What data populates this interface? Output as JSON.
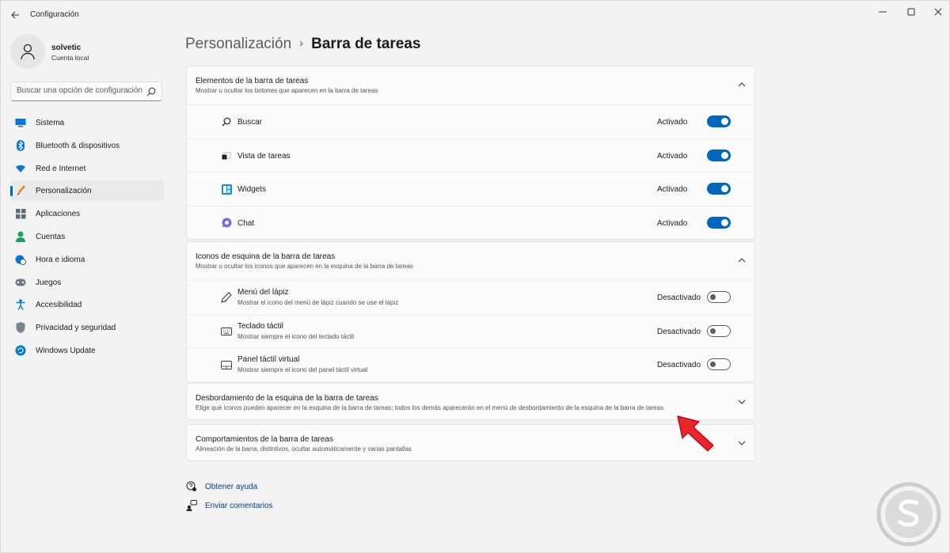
{
  "window": {
    "title": "Configuración",
    "controls": {
      "minimize": "—",
      "maximize": "☐",
      "close": "✕"
    }
  },
  "profile": {
    "name": "solvetic",
    "subtitle": "Cuenta local"
  },
  "search": {
    "placeholder": "Buscar una opción de configuración"
  },
  "sidebar": {
    "items": [
      {
        "label": "Sistema",
        "icon": "system-icon",
        "active": false
      },
      {
        "label": "Bluetooth & dispositivos",
        "icon": "bluetooth-icon",
        "active": false
      },
      {
        "label": "Red e Internet",
        "icon": "wifi-icon",
        "active": false
      },
      {
        "label": "Personalización",
        "icon": "brush-icon",
        "active": true
      },
      {
        "label": "Aplicaciones",
        "icon": "apps-icon",
        "active": false
      },
      {
        "label": "Cuentas",
        "icon": "person-icon",
        "active": false
      },
      {
        "label": "Hora e idioma",
        "icon": "globe-clock-icon",
        "active": false
      },
      {
        "label": "Juegos",
        "icon": "gamepad-icon",
        "active": false
      },
      {
        "label": "Accesibilidad",
        "icon": "accessibility-icon",
        "active": false
      },
      {
        "label": "Privacidad y seguridad",
        "icon": "shield-icon",
        "active": false
      },
      {
        "label": "Windows Update",
        "icon": "update-icon",
        "active": false
      }
    ]
  },
  "breadcrumb": {
    "parent": "Personalización",
    "separator": "›",
    "current": "Barra de tareas"
  },
  "sections": {
    "taskbar_items": {
      "title": "Elementos de la barra de tareas",
      "description": "Mostrar u ocultar los botones que aparecen en la barra de tareas",
      "rows": [
        {
          "label": "Buscar",
          "state": "Activado",
          "on": true
        },
        {
          "label": "Vista de tareas",
          "state": "Activado",
          "on": true
        },
        {
          "label": "Widgets",
          "state": "Activado",
          "on": true
        },
        {
          "label": "Chat",
          "state": "Activado",
          "on": true
        }
      ]
    },
    "corner_icons": {
      "title": "Iconos de esquina de la barra de tareas",
      "description": "Mostrar u ocultar los iconos que aparecen en la esquina de la barra de tareas",
      "rows": [
        {
          "label": "Menú del lápiz",
          "sub": "Mostrar el icono del menú de lápiz cuando se use el lápiz",
          "state": "Desactivado",
          "on": false
        },
        {
          "label": "Teclado táctil",
          "sub": "Mostrar siempre el icono del teclado táctil",
          "state": "Desactivado",
          "on": false
        },
        {
          "label": "Panel táctil virtual",
          "sub": "Mostrar siempre el icono del panel táctil virtual",
          "state": "Desactivado",
          "on": false
        }
      ]
    },
    "overflow": {
      "title": "Desbordamiento de la esquina de la barra de tareas",
      "description": "Elige qué iconos pueden aparecer en la esquina de la barra de tareas; todos los demás aparecerán en el menú de desbordamiento de la esquina de la barra de tareas"
    },
    "behaviors": {
      "title": "Comportamientos de la barra de tareas",
      "description": "Alineación de la barra, distintivos, ocultar automáticamente y varias pantallas"
    }
  },
  "links": {
    "help": "Obtener ayuda",
    "feedback": "Enviar comentarios"
  },
  "colors": {
    "accent": "#0067c0",
    "link": "#003e92",
    "annotation_arrow": "#e8252b",
    "background": "#f3f3f3",
    "card": "#fbfbfb"
  }
}
